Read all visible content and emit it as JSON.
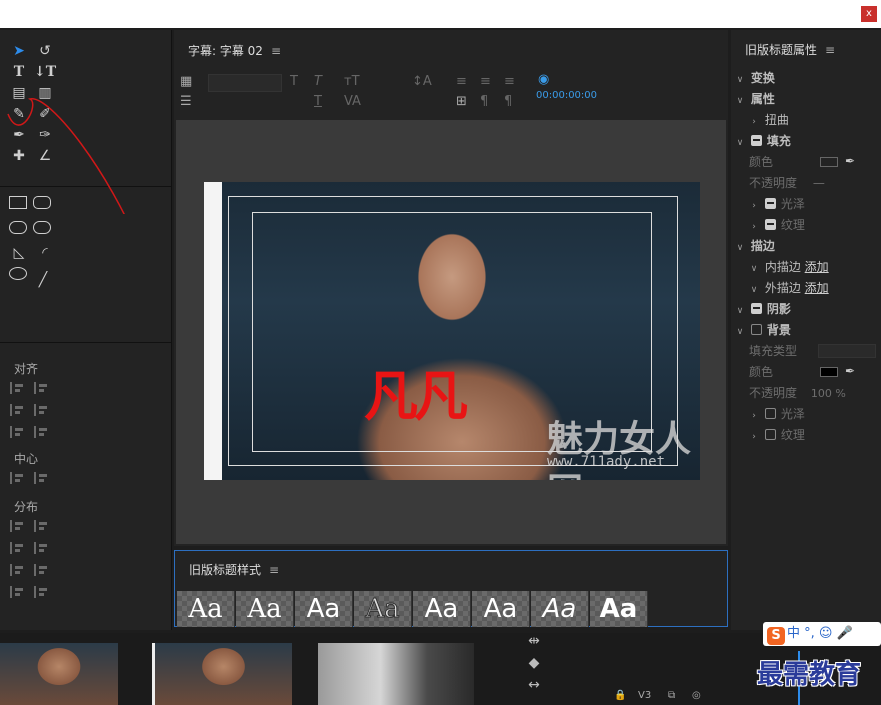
{
  "window": {
    "close_label": "x"
  },
  "tools": {
    "align_label": "对齐",
    "center_label": "中心",
    "distribute_label": "分布"
  },
  "editor": {
    "tab_title": "字幕: 字幕 02",
    "menu_glyph": "≡",
    "timecode": "00:00:00:00",
    "title_text": "凡凡",
    "watermark_text": "魅力女人网",
    "watermark_url": "www.711ady.net"
  },
  "styles_panel": {
    "title": "旧版标题样式",
    "menu_glyph": "≡",
    "swatches": [
      "Aa",
      "Aa",
      "Aa",
      "Aa",
      "Aa",
      "Aa",
      "Aa",
      "Aa"
    ]
  },
  "properties": {
    "title": "旧版标题属性",
    "menu_glyph": "≡",
    "transform": "变换",
    "attributes": "属性",
    "distort": "扭曲",
    "fill": "填充",
    "color": "颜色",
    "opacity": "不透明度",
    "opacity_value_fill": "—",
    "sheen": "光泽",
    "texture": "纹理",
    "stroke": "描边",
    "inner_stroke": "内描边",
    "outer_stroke": "外描边",
    "add": "添加",
    "shadow": "阴影",
    "background": "背景",
    "fill_type": "填充类型",
    "bg_color": "颜色",
    "bg_opacity": "不透明度",
    "bg_opacity_value": "100 %",
    "bg_sheen": "光泽",
    "bg_texture": "纹理"
  },
  "timeline": {
    "track_label": "V3"
  },
  "ime": {
    "logo": "S",
    "text": "中 °, ☺ 🎤"
  },
  "brand": {
    "text": "最需教育"
  }
}
